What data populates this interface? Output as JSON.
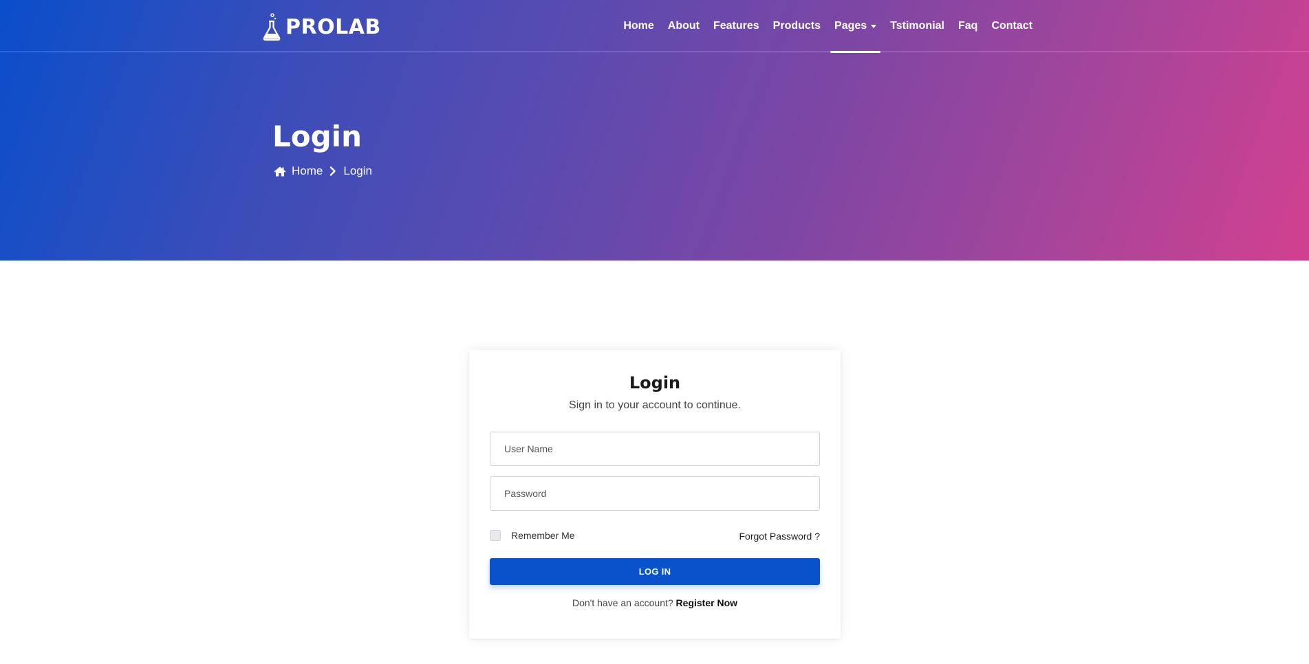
{
  "brand": {
    "name": "PROLAB"
  },
  "nav": {
    "items": [
      {
        "label": "Home"
      },
      {
        "label": "About"
      },
      {
        "label": "Features"
      },
      {
        "label": "Products"
      },
      {
        "label": "Pages",
        "active": true,
        "has_dropdown": true
      },
      {
        "label": "Tstimonial"
      },
      {
        "label": "Faq"
      },
      {
        "label": "Contact"
      }
    ]
  },
  "hero": {
    "title": "Login",
    "breadcrumb": {
      "home": "Home",
      "current": "Login"
    }
  },
  "login_card": {
    "title": "Login",
    "subtitle": "Sign in to your account to continue.",
    "username_placeholder": "User Name",
    "password_placeholder": "Password",
    "remember_label": "Remember Me",
    "forgot_label": "Forgot Password ?",
    "submit_label": "LOG IN",
    "register_prompt": "Don't have an account?",
    "register_link": "Register Now"
  },
  "colors": {
    "gradient_start": "#0a4ecb",
    "gradient_end": "#d2408f",
    "button": "#0a52c9"
  },
  "icons": {
    "logo": "flask-icon",
    "breadcrumb_home": "home-icon",
    "breadcrumb_separator": "chevron-right-icon",
    "dropdown": "caret-down-icon"
  }
}
